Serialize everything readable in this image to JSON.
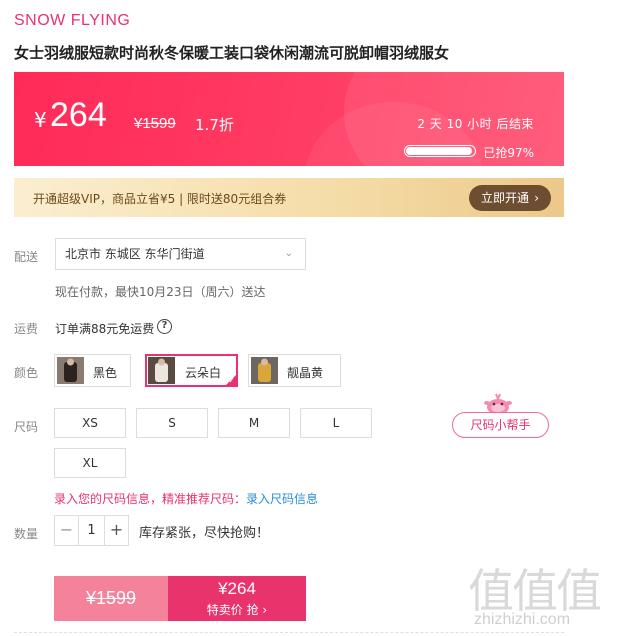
{
  "brand": "SNOW FLYING",
  "title": "女士羽绒服短款时尚秋冬保暖工装口袋休闲潮流可脱卸帽羽绒服女",
  "price_banner": {
    "currency": "¥",
    "price": "264",
    "original_price": "¥1599",
    "discount": "1.7折",
    "countdown": "2 天 10 小时 后结束",
    "sold_label": "已抢97%",
    "sold_percent": 97
  },
  "vip": {
    "text": "开通超级VIP，商品立省¥5 | 限时送80元组合券",
    "button_label": "立即开通",
    "button_arrow": "›"
  },
  "delivery": {
    "label": "配送",
    "address": "北京市 东城区 东华门街道",
    "estimate": "现在付款，最快10月23日（周六）送达"
  },
  "shipping": {
    "label": "运费",
    "text": "订单满88元免运费",
    "help_icon": "?"
  },
  "color": {
    "label": "颜色",
    "options": [
      {
        "name": "黑色",
        "swatch": "#3a2e2a"
      },
      {
        "name": "云朵白",
        "swatch": "#e8e2dc"
      },
      {
        "name": "靓晶黄",
        "swatch": "#d9a63a"
      }
    ],
    "selected": "云朵白"
  },
  "size": {
    "label": "尺码",
    "options": [
      "XS",
      "S",
      "M",
      "L",
      "XL"
    ],
    "helper_label": "尺码小帮手",
    "link_text": "录入您的尺码信息，精准推荐尺码：",
    "link_action": "录入尺码信息"
  },
  "quantity": {
    "label": "数量",
    "minus": "−",
    "value": "1",
    "plus": "+",
    "stock_text": "库存紧张，尽快抢购！"
  },
  "buy": {
    "original_price": "¥1599",
    "sale_price": "¥264",
    "sale_label": "特卖价 抢 ›"
  },
  "watermark": {
    "glyphs": "值值值",
    "url": "zhizhizhi.com"
  },
  "colors": {
    "accent": "#e8336d",
    "banner": "#ff2a58",
    "vip_button": "#6d4e31",
    "link_blue": "#2a8cd3"
  }
}
